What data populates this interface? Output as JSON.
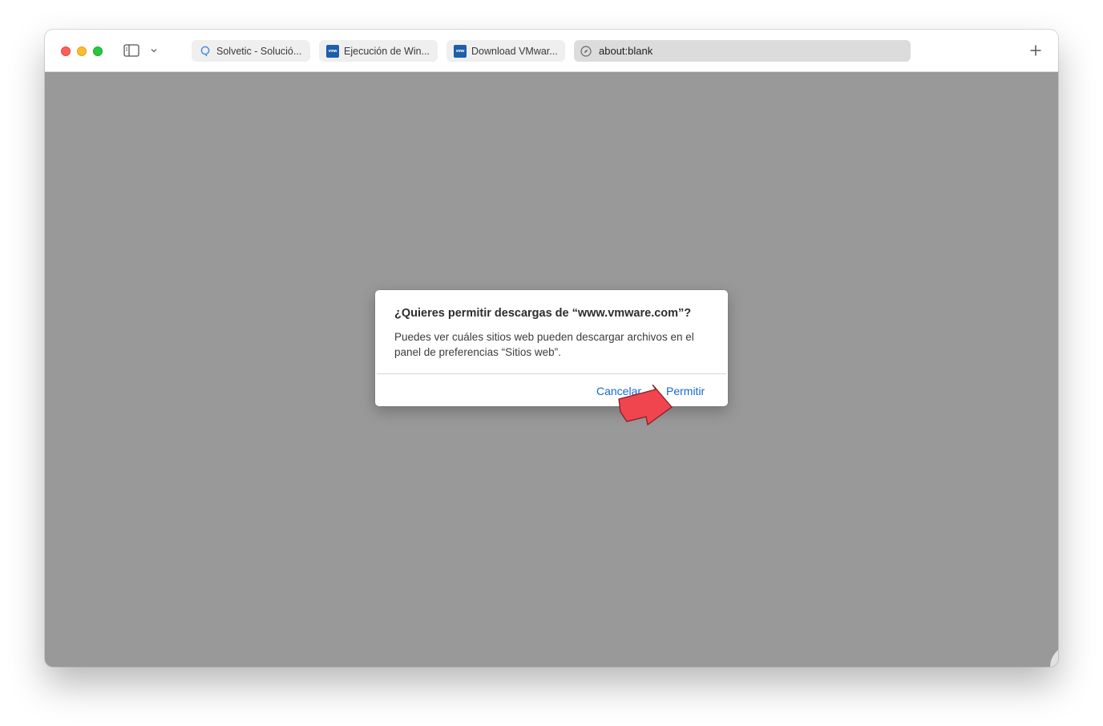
{
  "window": {
    "tabs": [
      {
        "label": "Solvetic - Solució...",
        "icon": "solvetic-favicon-icon"
      },
      {
        "label": "Ejecución de Win...",
        "icon": "vmware-favicon-icon",
        "icon_text": "vmw"
      },
      {
        "label": "Download VMwar...",
        "icon": "vmware-favicon-icon",
        "icon_text": "vmw"
      }
    ],
    "address": "about:blank",
    "new_tab_icon": "plus-icon",
    "sidebar_icon": "sidebar-icon"
  },
  "dialog": {
    "title": "¿Quieres permitir descargas de “www.vmware.com”?",
    "body": "Puedes ver cuáles sitios web pueden descargar archivos en el panel de preferencias “Sitios web”.",
    "cancel_label": "Cancelar",
    "allow_label": "Permitir"
  },
  "colors": {
    "link_blue": "#1468d4",
    "overlay_gray": "#999999",
    "arrow_red": "#f0454f"
  },
  "annotation": {
    "icon": "red-arrow-icon"
  },
  "watermark": {
    "icon": "solvetic-logo-icon"
  }
}
